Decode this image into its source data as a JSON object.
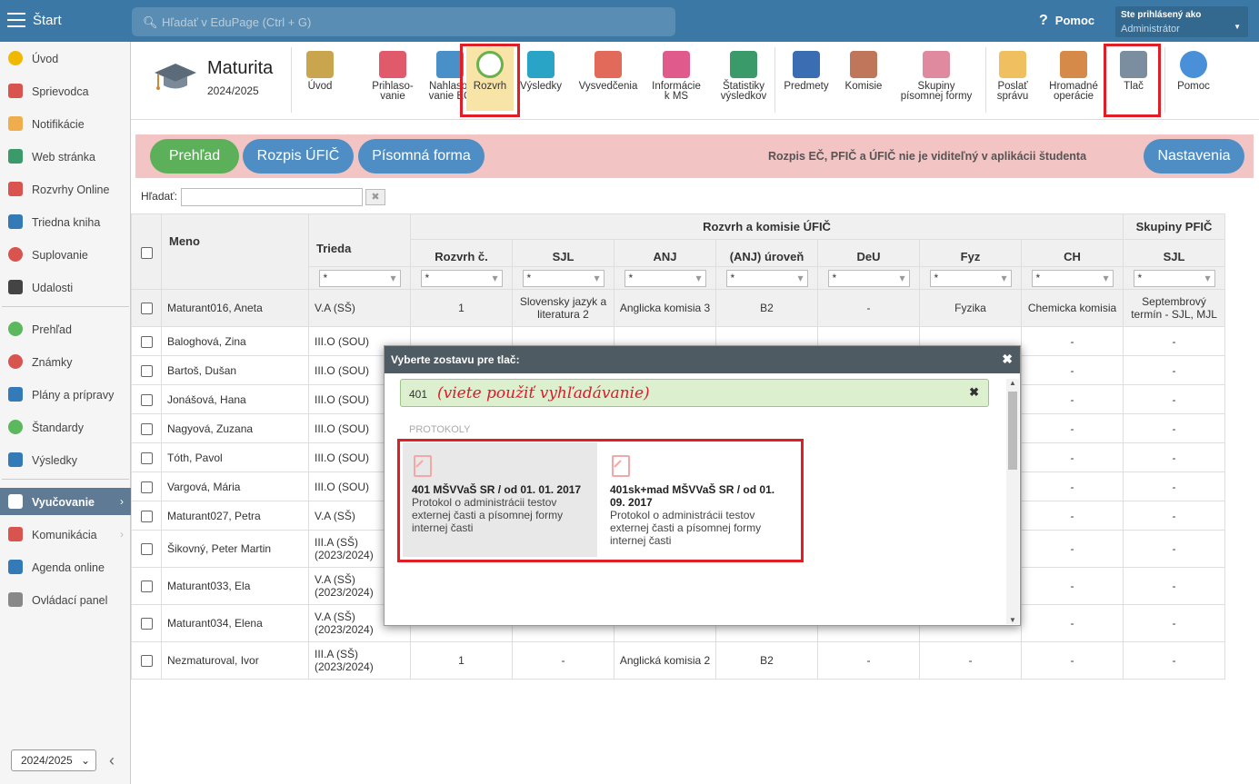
{
  "topbar": {
    "start": "Štart",
    "search_placeholder": "Hľadať v EduPage (Ctrl + G)",
    "help": "Pomoc",
    "user_line1": "Ste prihlásený ako",
    "user_line2": "Administrátor"
  },
  "sidebar": {
    "items": [
      {
        "label": "Úvod",
        "icon": "star-icon",
        "color": "#f0b800"
      },
      {
        "label": "Sprievodca",
        "icon": "wizard-icon",
        "color": "#d9534f"
      },
      {
        "label": "Notifikácie",
        "icon": "envelope-icon",
        "color": "#f0ad4e"
      },
      {
        "label": "Web stránka",
        "icon": "home-icon",
        "color": "#3a9a6a"
      },
      {
        "label": "Rozvrhy Online",
        "icon": "calendar-icon",
        "color": "#d9534f"
      },
      {
        "label": "Triedna kniha",
        "icon": "book-icon",
        "color": "#337ab7"
      },
      {
        "label": "Suplovanie",
        "icon": "user-icon",
        "color": "#d9534f"
      },
      {
        "label": "Udalosti",
        "icon": "calendar-grid-icon",
        "color": "#444444"
      },
      {
        "label": "Prehľad",
        "icon": "check-circle-icon",
        "color": "#5cb85c"
      },
      {
        "label": "Známky",
        "icon": "grade-icon",
        "color": "#d9534f"
      },
      {
        "label": "Plány a prípravy",
        "icon": "briefcase-icon",
        "color": "#337ab7"
      },
      {
        "label": "Štandardy",
        "icon": "shield-check-icon",
        "color": "#5cb85c"
      },
      {
        "label": "Výsledky",
        "icon": "bar-chart-icon",
        "color": "#337ab7"
      },
      {
        "label": "Vyučovanie",
        "icon": "open-book-icon",
        "color": "#ffffff"
      },
      {
        "label": "Komunikácia",
        "icon": "chat-icon",
        "color": "#d9534f"
      },
      {
        "label": "Agenda online",
        "icon": "pencil-icon",
        "color": "#337ab7"
      },
      {
        "label": "Ovládací panel",
        "icon": "gear-icon",
        "color": "#888888"
      }
    ],
    "year": "2024/2025"
  },
  "module": {
    "title": "Maturita",
    "year": "2024/2025"
  },
  "toolbar": [
    {
      "label": "Úvod",
      "icon": "students-icon",
      "color": "#c9a54e"
    },
    {
      "label": "Prihlaso-\nvanie",
      "icon": "form-icon",
      "color": "#e05a6c"
    },
    {
      "label": "Nahlaso-\nvanie EČ",
      "icon": "arrow-right-icon",
      "color": "#4a90c8"
    },
    {
      "label": "Rozvrh",
      "icon": "clock-icon",
      "color": "#6ab04c"
    },
    {
      "label": "Výsledky",
      "icon": "bar-chart-icon",
      "color": "#29a3c6"
    },
    {
      "label": "Vysvedčenia",
      "icon": "certificate-icon",
      "color": "#e26a5a"
    },
    {
      "label": "Informácie\nk MS",
      "icon": "info-list-icon",
      "color": "#e05a8c"
    },
    {
      "label": "Štatistiky\nvýsledkov",
      "icon": "stats-icon",
      "color": "#3a9a6a"
    },
    {
      "label": "Predmety",
      "icon": "book-icon",
      "color": "#3b6db3"
    },
    {
      "label": "Komisie",
      "icon": "committee-icon",
      "color": "#c0765a"
    },
    {
      "label": "Skupiny\npísomnej formy",
      "icon": "group-icon",
      "color": "#e08aa0"
    },
    {
      "label": "Poslať\nsprávu",
      "icon": "envelope-icon",
      "color": "#f0c060"
    },
    {
      "label": "Hromadné\noperácie",
      "icon": "people-icon",
      "color": "#d68a4a"
    },
    {
      "label": "Tlač",
      "icon": "printer-icon",
      "color": "#7a8ea0"
    },
    {
      "label": "Pomoc",
      "icon": "question-icon",
      "color": "#4a90d9"
    }
  ],
  "tabs": {
    "overview": "Prehľad",
    "schedule": "Rozpis ÚFIČ",
    "written": "Písomná forma",
    "note": "Rozpis EČ, PFIČ a ÚFIČ nie je viditeľný v aplikácii študenta",
    "settings": "Nastavenia"
  },
  "filter": {
    "label": "Hľadať:",
    "clear": "✖"
  },
  "table": {
    "group_ufic": "Rozvrh a komisie ÚFIČ",
    "group_pfic": "Skupiny PFIČ",
    "col_name": "Meno",
    "col_class": "Trieda",
    "cols": [
      "Rozvrh č.",
      "SJL",
      "ANJ",
      "(ANJ) úroveň",
      "DeU",
      "Fyz",
      "CH"
    ],
    "col_pfic": "SJL",
    "filter_value": "*",
    "rows": [
      {
        "name": "Maturant016, Aneta",
        "class": "V.A (SŠ)",
        "c": [
          "1",
          "Slovensky jazyk a literatura 2",
          "Anglicka komisia 3",
          "B2",
          "-",
          "Fyzika",
          "Chemicka komisia"
        ],
        "pfic": "Septembrový termín - SJL, MJL"
      },
      {
        "name": "Baloghová, Zina",
        "class": "III.O (SOU)",
        "c": [
          "",
          "",
          "",
          "",
          "",
          "",
          "-"
        ],
        "pfic": "-"
      },
      {
        "name": "Bartoš, Dušan",
        "class": "III.O (SOU)",
        "c": [
          "",
          "",
          "",
          "",
          "",
          "",
          "-"
        ],
        "pfic": "-"
      },
      {
        "name": "Jonášová, Hana",
        "class": "III.O (SOU)",
        "c": [
          "",
          "",
          "",
          "",
          "",
          "",
          "-"
        ],
        "pfic": "-"
      },
      {
        "name": "Nagyová, Zuzana",
        "class": "III.O (SOU)",
        "c": [
          "",
          "",
          "",
          "",
          "",
          "",
          "-"
        ],
        "pfic": "-"
      },
      {
        "name": "Tóth, Pavol",
        "class": "III.O (SOU)",
        "c": [
          "",
          "",
          "",
          "",
          "",
          "",
          "-"
        ],
        "pfic": "-"
      },
      {
        "name": "Vargová, Mária",
        "class": "III.O (SOU)",
        "c": [
          "",
          "",
          "",
          "",
          "",
          "",
          "-"
        ],
        "pfic": "-"
      },
      {
        "name": "Maturant027, Petra",
        "class": "V.A (SŠ)",
        "c": [
          "",
          "",
          "",
          "",
          "",
          "",
          "-"
        ],
        "pfic": "-"
      },
      {
        "name": "Šikovný, Peter Martin",
        "class": "III.A (SŠ) (2023/2024)",
        "c": [
          "",
          "",
          "",
          "",
          "",
          "",
          "-"
        ],
        "pfic": "-"
      },
      {
        "name": "Maturant033, Ela",
        "class": "V.A (SŠ) (2023/2024)",
        "c": [
          "",
          "",
          "",
          "",
          "",
          "",
          "-"
        ],
        "pfic": "-"
      },
      {
        "name": "Maturant034, Elena",
        "class": "V.A (SŠ) (2023/2024)",
        "c": [
          "",
          "",
          "",
          "",
          "",
          "",
          "-"
        ],
        "pfic": "-"
      },
      {
        "name": "Nezmaturoval, Ivor",
        "class": "III.A (SŠ) (2023/2024)",
        "c": [
          "1",
          "-",
          "Anglická komisia 2",
          "B2",
          "-",
          "-",
          "-"
        ],
        "pfic": "-"
      }
    ]
  },
  "modal": {
    "title": "Vyberte zostavu pre tlač:",
    "search_value": "401",
    "search_hint": "(viete použiť vyhľadávanie)",
    "group": "PROTOKOLY",
    "cards": [
      {
        "title": "401 MŠVVaŠ SR / od 01. 01. 2017",
        "desc": "Protokol o administrácii testov externej časti a písomnej formy internej časti"
      },
      {
        "title": "401sk+mad MŠVVaŠ SR / od 01. 09. 2017",
        "desc": "Protokol o administrácii testov externej časti a písomnej formy internej časti"
      }
    ]
  }
}
